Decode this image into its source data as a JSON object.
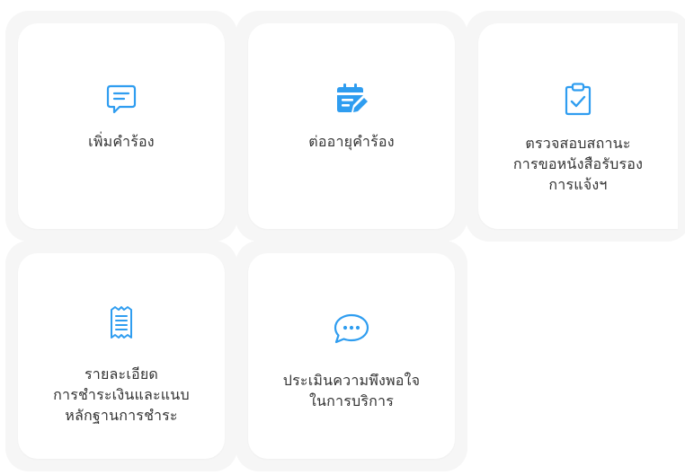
{
  "accent_color": "#2f9df0",
  "cards": [
    {
      "icon": "chat-message-icon",
      "lines": [
        "เพิ่มคำร้อง"
      ]
    },
    {
      "icon": "calendar-edit-icon",
      "lines": [
        "ต่ออายุคำร้อง"
      ]
    },
    {
      "icon": "clipboard-check-icon",
      "lines": [
        "ตรวจสอบสถานะ",
        "การขอหนังสือรับรอง",
        "การแจ้งฯ"
      ]
    },
    {
      "icon": "receipt-icon",
      "lines": [
        "รายละเอียด",
        "การชำระเงินและแนบ",
        "หลักฐานการชำระ"
      ]
    },
    {
      "icon": "chat-bubble-dots-icon",
      "lines": [
        "ประเมินความพึงพอใจ",
        "ในการบริการ"
      ]
    }
  ]
}
